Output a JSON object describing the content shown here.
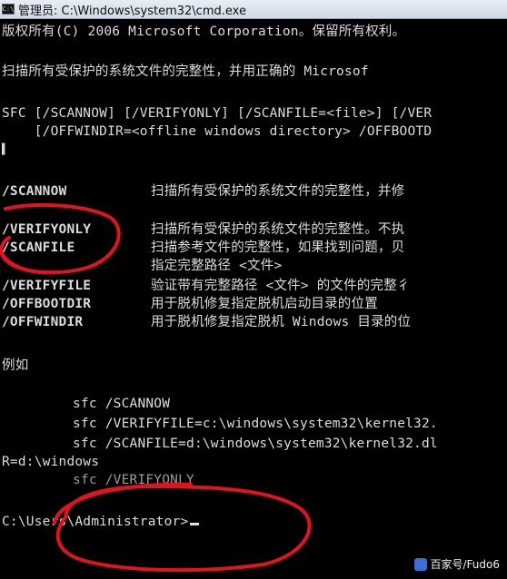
{
  "window": {
    "title": "管理员: C:\\Windows\\system32\\cmd.exe"
  },
  "console": {
    "lines": [
      "版权所有(C) 2006 Microsoft Corporation。保留所有权利。",
      "扫描所有受保护的系统文件的完整性，并用正确的 Microsof",
      "SFC [/SCANNOW] [/VERIFYONLY] [/SCANFILE=<file>] [/VER",
      "    [/OFFWINDIR=<offline windows directory> /OFFBOOTD",
      "/SCANNOW",
      "扫描所有受保护的系统文件的完整性，并修",
      "/VERIFYONLY",
      "扫描所有受保护的系统文件的完整性。不执",
      "/SCANFILE",
      "扫描参考文件的完整性，如果找到问题，贝",
      "指定完整路径 <文件>",
      "/VERIFYFILE",
      "验证带有完整路径 <文件> 的文件的完整彳",
      "/OFFBOOTDIR",
      "用于脱机修复指定脱机启动目录的位置",
      "/OFFWINDIR",
      "用于脱机修复指定脱机 Windows 目录的位",
      "例如",
      "sfc /SCANNOW",
      "sfc /VERIFYFILE=c:\\windows\\system32\\kernel32.",
      "sfc /SCANFILE=d:\\windows\\system32\\kernel32.dl",
      "R=d:\\windows",
      "sfc /VERIFYONLY",
      "C:\\Users\\Administrator>"
    ]
  },
  "watermark": {
    "text": "百家号/Fudo6"
  },
  "colors": {
    "background": "#000000",
    "text": "#dcdcdc",
    "annotation": "#e0141e"
  }
}
